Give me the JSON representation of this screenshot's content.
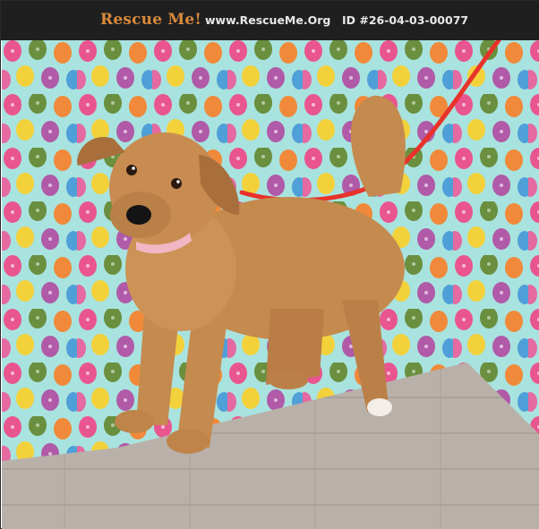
{
  "header": {
    "brand": "Rescue Me!",
    "site": "www.RescueMe.Org",
    "pet_id": "ID #26-04-03-00077",
    "brand_color": "#d98a3c",
    "bar_color": "#1f1f1f"
  },
  "photo": {
    "subject": "dog-icon",
    "colors": {
      "backdrop": "#a9e3df",
      "floor": "#b9b1a9",
      "fur": "#c58a4e",
      "leash": "#e8322a",
      "collar": "#f2b7c4"
    }
  }
}
